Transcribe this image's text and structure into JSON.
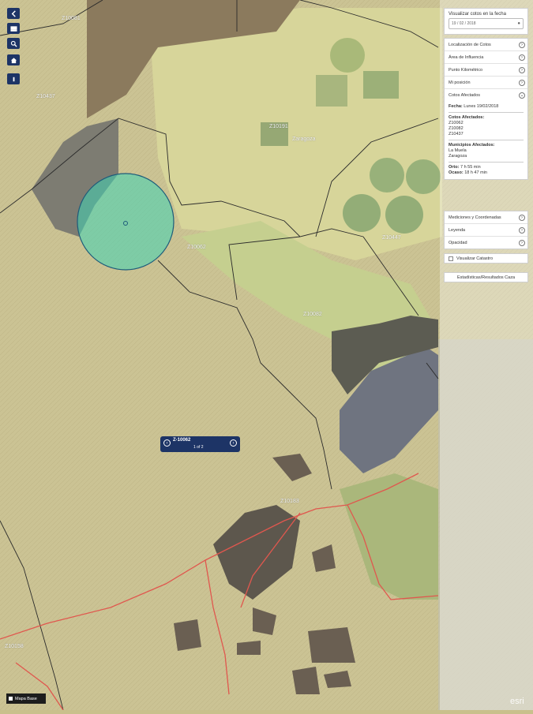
{
  "toolbar": {
    "buttons": [
      {
        "name": "back-icon"
      },
      {
        "name": "layers-icon"
      },
      {
        "name": "search-icon"
      },
      {
        "name": "home-icon"
      },
      {
        "name": "info-icon"
      }
    ]
  },
  "date_box": {
    "title": "Visualizar cotos en la fecha",
    "date_value": "19 / 02 / 2018"
  },
  "menu1": [
    {
      "label": "Localización de Cotos",
      "icon": "chevron-right-icon"
    },
    {
      "label": "Área de Influencia",
      "icon": "chevron-right-icon"
    },
    {
      "label": "Punto Kilométrico",
      "icon": "chevron-right-icon"
    },
    {
      "label": "Mi posición",
      "icon": "chevron-right-icon"
    },
    {
      "label": "Cotos Afectados",
      "icon": "chevron-down-icon"
    }
  ],
  "affected": {
    "fecha_label": "Fecha:",
    "fecha_value": "Lunes 19/02/2018",
    "cotos_label": "Cotos Afectados:",
    "cotos": [
      "Z10062",
      "Z10082",
      "Z10437"
    ],
    "municipios_label": "Municipios Afectados:",
    "municipios": [
      "La Muela",
      "Zaragoza"
    ],
    "orto_label": "Orto:",
    "orto_value": "7 h 55 min",
    "ocaso_label": "Ocaso:",
    "ocaso_value": "18 h 47 min"
  },
  "menu2": [
    {
      "label": "Mediciones y Coordenadas",
      "icon": "chevron-right-icon"
    },
    {
      "label": "Leyenda",
      "icon": "chevron-right-icon"
    },
    {
      "label": "Opacidad",
      "icon": "chevron-right-icon"
    }
  ],
  "checkbox_label": "Visualizar Catastro",
  "stats_button": "Estadísticas/Resultados Caza",
  "popup": {
    "title": "Z-10062",
    "pager": "1 of 2"
  },
  "basemap_label": "Mapa Base",
  "attribution": "esri",
  "map_labels": [
    {
      "text": "Z10081"
    },
    {
      "text": "Z10437"
    },
    {
      "text": "Z10191"
    },
    {
      "text": "Zaragoza"
    },
    {
      "text": "Z10062"
    },
    {
      "text": "Z10447"
    },
    {
      "text": "Z10082"
    },
    {
      "text": "Z10183"
    },
    {
      "text": "Z10158"
    }
  ],
  "colors": {
    "panel_button": "#1d3466",
    "buffer_fill": "#3fd3b5",
    "road": "#e0574e",
    "boundary": "#2b2b2b"
  }
}
